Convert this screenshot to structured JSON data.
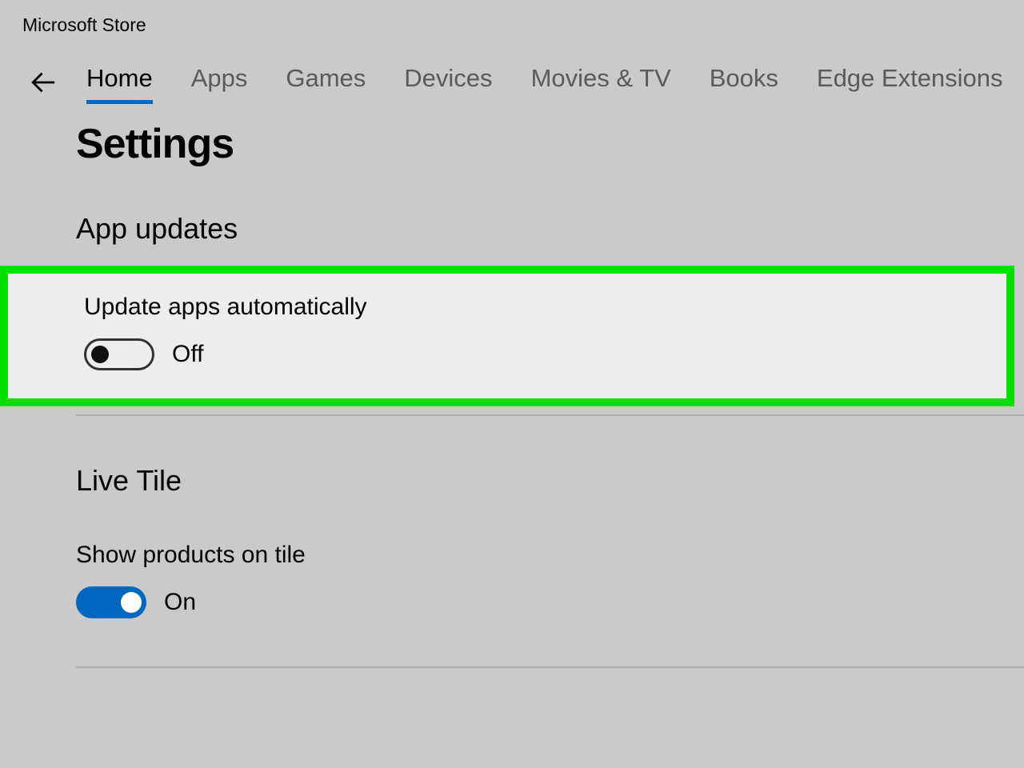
{
  "app_title": "Microsoft Store",
  "nav": {
    "tabs": [
      {
        "label": "Home",
        "active": true
      },
      {
        "label": "Apps",
        "active": false
      },
      {
        "label": "Games",
        "active": false
      },
      {
        "label": "Devices",
        "active": false
      },
      {
        "label": "Movies & TV",
        "active": false
      },
      {
        "label": "Books",
        "active": false
      },
      {
        "label": "Edge Extensions",
        "active": false
      }
    ]
  },
  "page": {
    "title": "Settings",
    "sections": [
      {
        "title": "App updates",
        "setting_label": "Update apps automatically",
        "toggle_state": "Off",
        "toggle_on": false,
        "highlighted": true
      },
      {
        "title": "Live Tile",
        "setting_label": "Show products on tile",
        "toggle_state": "On",
        "toggle_on": true,
        "highlighted": false
      }
    ]
  }
}
